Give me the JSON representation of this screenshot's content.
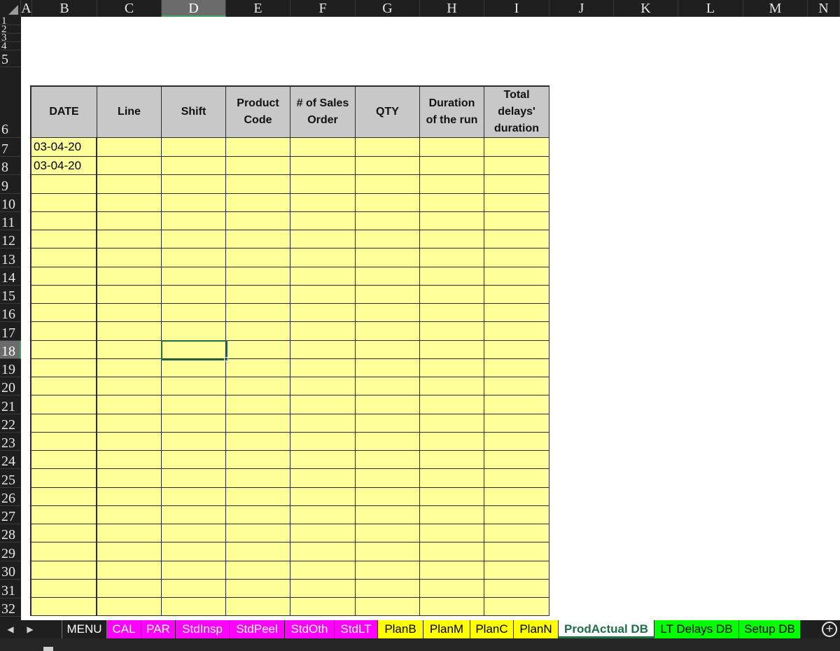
{
  "columns": [
    "A",
    "B",
    "C",
    "D",
    "E",
    "F",
    "G",
    "H",
    "I",
    "J",
    "K",
    "L",
    "M",
    "N"
  ],
  "selected_column": "D",
  "rows": [
    "1",
    "2",
    "3",
    "4",
    "5",
    "6",
    "7",
    "8",
    "9",
    "10",
    "11",
    "12",
    "13",
    "14",
    "15",
    "16",
    "17",
    "18",
    "19",
    "20",
    "21",
    "22",
    "23",
    "24",
    "25",
    "26",
    "27",
    "28",
    "29",
    "30",
    "31",
    "32"
  ],
  "selected_row": "18",
  "table": {
    "headers": [
      "DATE",
      "Line",
      "Shift",
      "Product\nCode",
      "# of Sales\nOrder",
      "QTY",
      "Duration\nof the run",
      "Total\ndelays'\nduration"
    ],
    "data_rows": [
      [
        "03-04-20",
        "",
        "",
        "",
        "",
        "",
        "",
        ""
      ],
      [
        "03-04-20",
        "",
        "",
        "",
        "",
        "",
        "",
        ""
      ]
    ],
    "fill_color": "#ffff99",
    "header_color": "#c8c8c8"
  },
  "sheet_tabs": [
    {
      "label": "MENU",
      "style": "menu"
    },
    {
      "label": "CAL",
      "style": "magenta"
    },
    {
      "label": "PAR",
      "style": "magenta"
    },
    {
      "label": "StdInsp",
      "style": "magenta"
    },
    {
      "label": "StdPeel",
      "style": "magenta"
    },
    {
      "label": "StdOth",
      "style": "magenta"
    },
    {
      "label": "StdLT",
      "style": "magenta"
    },
    {
      "label": "PlanB",
      "style": "yellow"
    },
    {
      "label": "PlanM",
      "style": "yellow"
    },
    {
      "label": "PlanC",
      "style": "yellow"
    },
    {
      "label": "PlanN",
      "style": "yellow"
    },
    {
      "label": "ProdActual DB",
      "style": "active"
    },
    {
      "label": "LT Delays DB",
      "style": "green"
    },
    {
      "label": "Setup DB",
      "style": "green"
    }
  ],
  "icons": {
    "prev_sheet": "◀",
    "next_sheet": "▶",
    "add_sheet": "+"
  },
  "colors": {
    "selection": "#1e7145",
    "magenta_tab": "#ff00ff",
    "yellow_tab": "#ffff00",
    "green_tab": "#00ff00"
  }
}
